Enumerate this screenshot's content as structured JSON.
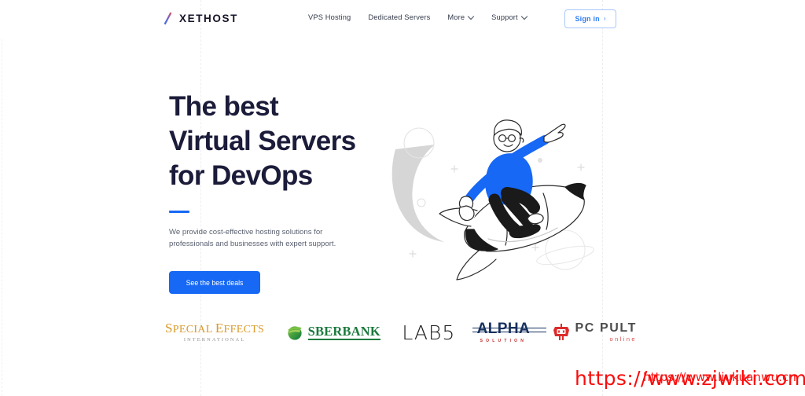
{
  "brand": {
    "name": "XETHOST",
    "mark_colors": [
      "#3b6fe0",
      "#e0483b"
    ]
  },
  "nav": {
    "items": [
      {
        "label": "VPS Hosting",
        "has_chevron": false,
        "icon": ""
      },
      {
        "label": "Dedicated Servers",
        "has_chevron": false,
        "icon": ""
      },
      {
        "label": "More",
        "has_chevron": true,
        "icon": "chevron-down-icon"
      },
      {
        "label": "Support",
        "has_chevron": true,
        "icon": "chevron-down-icon"
      }
    ],
    "signin": {
      "label": "Sign in",
      "arrow": "›"
    }
  },
  "hero": {
    "headline_lines": [
      "The best",
      "Virtual Servers",
      "for DevOps"
    ],
    "subtitle": "We provide cost-effective hosting solutions for professionals and businesses with expert support.",
    "cta_label": "See the best deals",
    "illustration_alt": "man-riding-rocket-illustration"
  },
  "logos": [
    {
      "id": "special-effects",
      "top": "SPECIAL EFFECTS",
      "bottom": "INTERNATIONAL",
      "color": "#d99a2b"
    },
    {
      "id": "sberbank",
      "name": "SBERBANK",
      "color": "#1b7a3d"
    },
    {
      "id": "lab5",
      "name": "LAB5",
      "color": "#1a1a1a"
    },
    {
      "id": "alpha",
      "name": "ALPHA",
      "sub": "SOLUTION",
      "color": "#16305e"
    },
    {
      "id": "pc-pult",
      "main": "PC PULT",
      "sub": "online",
      "color": "#4c4c4c"
    }
  ],
  "watermarks": {
    "primary": "https://www.zjwiki.com",
    "secondary": "https://www.liukuanwu.cn"
  },
  "colors": {
    "accent_blue": "#1668f5",
    "headline_navy": "#1b1b3a",
    "body_grey": "#5b6170",
    "page_bg": "#ffffff"
  }
}
